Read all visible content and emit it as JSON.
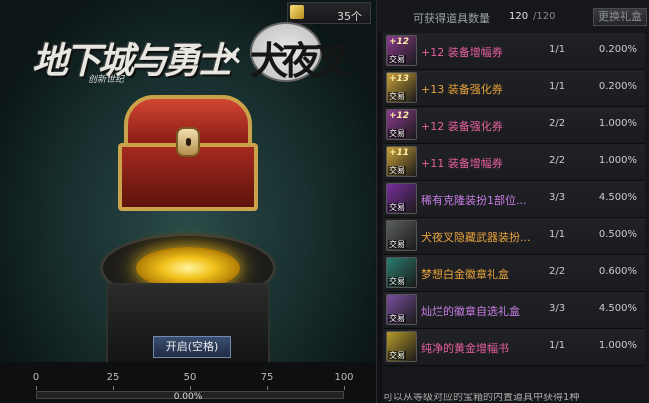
{
  "header": {
    "counter_value": "35个",
    "title": "可获得道具数量",
    "count_current": "120",
    "count_total": "/120",
    "refresh_label": "更换礼盒"
  },
  "logo": {
    "main_text": "地下城与勇士",
    "sub_text": "创新世纪",
    "x_mark": "×",
    "collab_text": "犬夜叉"
  },
  "open_button": "开启(空格)",
  "progress": {
    "ticks": [
      "0",
      "25",
      "50",
      "75",
      "100"
    ],
    "percent": "0.00%",
    "fraction": 0.0
  },
  "items": [
    {
      "badge": "+12",
      "trade": "交易",
      "name": "+12 装备增幅券",
      "qty": "1/1",
      "rate": "0.200%",
      "color": "#e8609c",
      "icon_bg": "#8b3b8f"
    },
    {
      "badge": "+13",
      "trade": "交易",
      "name": "+13 装备强化券",
      "qty": "1/1",
      "rate": "0.200%",
      "color": "#e8a23c",
      "icon_bg": "#caa23a"
    },
    {
      "badge": "+12",
      "trade": "交易",
      "name": "+12 装备强化券",
      "qty": "2/2",
      "rate": "1.000%",
      "color": "#e8609c",
      "icon_bg": "#8b3b8f"
    },
    {
      "badge": "+11",
      "trade": "交易",
      "name": "+11 装备增幅券",
      "qty": "2/2",
      "rate": "1.000%",
      "color": "#e8609c",
      "icon_bg": "#caa23a"
    },
    {
      "badge": "",
      "trade": "交易",
      "name": "稀有克隆装扮1部位...",
      "qty": "3/3",
      "rate": "4.500%",
      "color": "#c77ee6",
      "icon_bg": "#7a2f9e"
    },
    {
      "badge": "",
      "trade": "交易",
      "name": "犬夜叉隐藏武器装扮...",
      "qty": "1/1",
      "rate": "0.500%",
      "color": "#e8a23c",
      "icon_bg": "#5a5f5a"
    },
    {
      "badge": "",
      "trade": "交易",
      "name": "梦想白金徽章礼盒",
      "qty": "2/2",
      "rate": "0.600%",
      "color": "#e8a23c",
      "icon_bg": "#2b7d6f"
    },
    {
      "badge": "",
      "trade": "交易",
      "name": "灿烂的徽章自选礼盒",
      "qty": "3/3",
      "rate": "4.500%",
      "color": "#c77ee6",
      "icon_bg": "#7a4f9e"
    },
    {
      "badge": "",
      "trade": "交易",
      "name": "纯净的黄金增幅书",
      "qty": "1/1",
      "rate": "1.000%",
      "color": "#e8609c",
      "icon_bg": "#b89b2a"
    }
  ],
  "footer_note": "可以从等级对应的宝箱的内置道具中获得1种"
}
